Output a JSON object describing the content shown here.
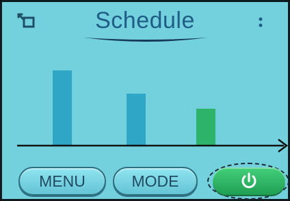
{
  "header": {
    "title": "Schedule",
    "back_icon": "back-icon",
    "more_icon": "more-vertical-icon"
  },
  "chart_data": {
    "type": "bar",
    "categories": [
      "",
      "",
      ""
    ],
    "values": [
      110,
      76,
      54
    ],
    "ylim": [
      0,
      140
    ],
    "colors": [
      "#2fa6c5",
      "#2fa6c5",
      "#2db36a"
    ],
    "grid": false
  },
  "footer": {
    "menu_label": "MENU",
    "mode_label": "MODE",
    "power_icon": "power-icon"
  },
  "colors": {
    "background": "#73d0dd",
    "title": "#1f5d87",
    "power_button": "#2cb862"
  }
}
